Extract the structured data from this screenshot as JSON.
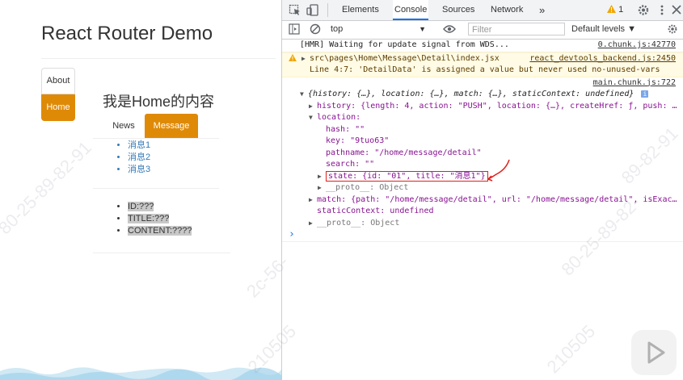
{
  "app": {
    "title": "React Router Demo",
    "nav": {
      "about": "About",
      "home": "Home"
    },
    "home_heading": "我是Home的内容",
    "tabs": {
      "news": "News",
      "message": "Message"
    },
    "messages": [
      "消息1",
      "消息2",
      "消息3"
    ],
    "detail": {
      "id": "ID:???",
      "title": "TITLE:???",
      "content": "CONTENT:????"
    },
    "accent_color": "#df8a07"
  },
  "devtools": {
    "tabs": [
      "Elements",
      "Console",
      "Sources",
      "Network"
    ],
    "active_tab": "Console",
    "more": "»",
    "warnings": "1",
    "context": "top",
    "filter_placeholder": "Filter",
    "levels": "Default levels ▼",
    "lines": {
      "hmr": "[HMR] Waiting for update signal from WDS...",
      "hmr_src": "0.chunk.js:42770",
      "warn_path": "src\\pages\\Home\\Message\\Detail\\index.jsx",
      "warn_src": "react_devtools_backend.js:2450",
      "warn_msg": "Line 4:7:  'DetailData' is assigned a value but never used  no-unused-vars",
      "main_src": "main.chunk.js:722",
      "props": "{history: {…}, location: {…}, match: {…}, staticContext: undefined}",
      "history": "history: {length: 4, action: \"PUSH\", location: {…}, createHref: ƒ, push: …",
      "location": "location:",
      "hash": "hash: \"\"",
      "key": "key: \"9tuo63\"",
      "pathname": "pathname: \"/home/message/detail\"",
      "search": "search: \"\"",
      "state": "state: {id: \"01\", title: \"消息1\"}",
      "proto1": "__proto__: Object",
      "match": "match: {path: \"/home/message/detail\", url: \"/home/message/detail\", isExac…",
      "static": "staticContext: undefined",
      "proto2": "__proto__: Object",
      "prompt": "›"
    }
  },
  "watermarks": [
    "2c-56-",
    "80-25-89-82-91",
    "210505",
    "89-82-91",
    "80-25-89-82-",
    "2c-56-"
  ]
}
